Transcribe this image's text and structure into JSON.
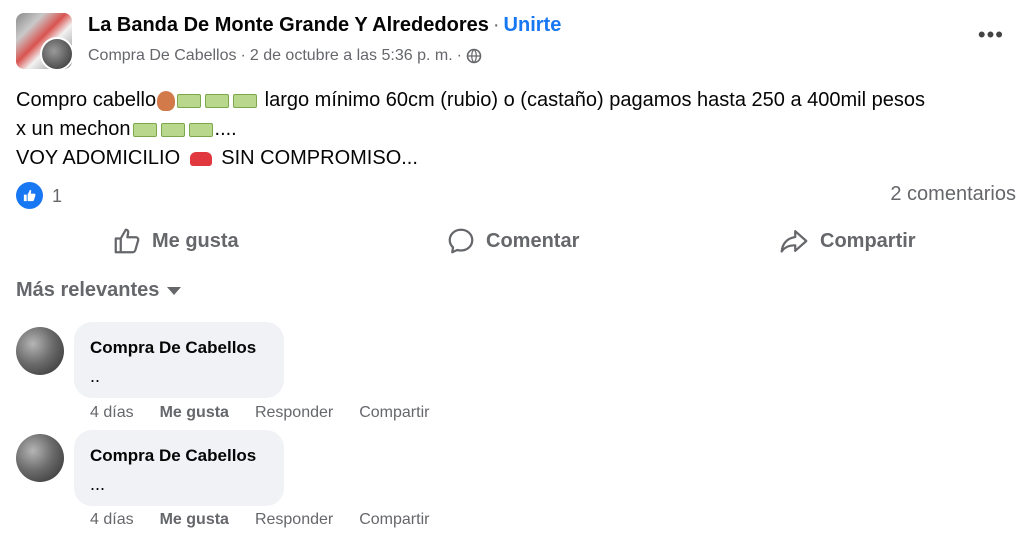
{
  "post": {
    "group_name": "La Banda De Monte Grande Y Alrededores",
    "separator": "·",
    "join_label": "Unirte",
    "author": "Compra De Cabellos",
    "date": "2 de octubre a las 5:36 p. m.",
    "audience_icon": "globe-icon",
    "text": {
      "l1a": "Compro cabello",
      "l1b": " largo mínimo 60cm (rubio) o (castaño) pagamos hasta 250 a 400mil pesos",
      "l2a": "x un mechon",
      "l2b": "....",
      "l3a": "VOY ADOMICILIO ",
      "l3b": " SIN COMPROMISO..."
    },
    "reactions_count": "1",
    "comments_count": "2 comentarios"
  },
  "actions": {
    "like": "Me gusta",
    "comment": "Comentar",
    "share": "Compartir"
  },
  "comments_sort": "Más relevantes",
  "comments": [
    {
      "author": "Compra De Cabellos",
      "text": "..",
      "time": "4 días",
      "like": "Me gusta",
      "reply": "Responder",
      "share": "Compartir"
    },
    {
      "author": "Compra De Cabellos",
      "text": "...",
      "time": "4 días",
      "like": "Me gusta",
      "reply": "Responder",
      "share": "Compartir"
    }
  ],
  "colors": {
    "accent": "#1877f2",
    "muted": "#65676b",
    "bubble": "#f0f2f5"
  }
}
